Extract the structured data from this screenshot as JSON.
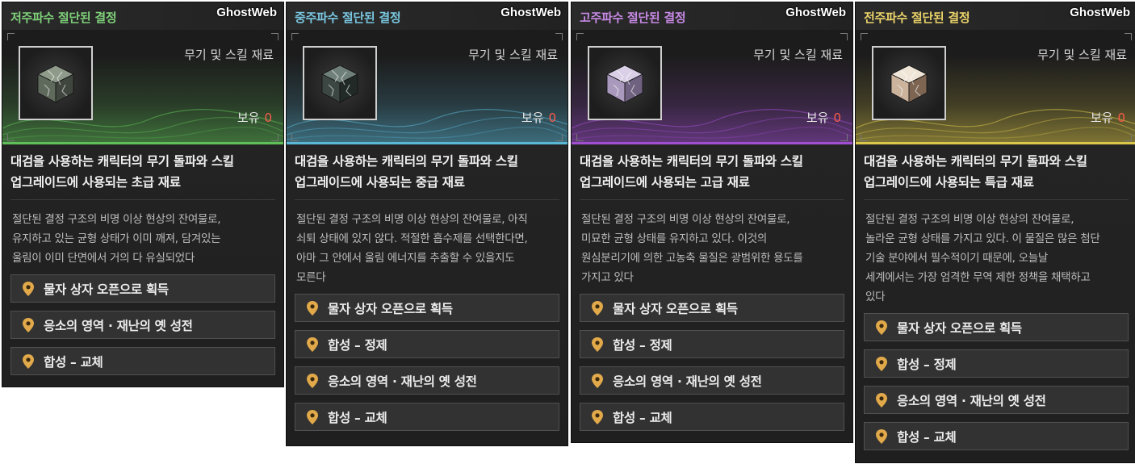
{
  "watermark": "GhostWeb",
  "cards": [
    {
      "title": "저주파수 절단된 결정",
      "title_color": "#7fd17a",
      "accent": "#5fbf58",
      "category": "무기 및 스킬 재료",
      "owned_label": "보유",
      "owned_count": "0",
      "summary": [
        "대검을 사용하는 캐릭터의 무기 돌파와 스킬",
        "업그레이드에 사용되는 초급 재료"
      ],
      "lore": [
        "절단된 결정 구조의 비명 이상 현상의 잔여물로,",
        "유지하고 있는 균형 상태가 이미 깨져, 담겨있는",
        "울림이 이미 단면에서 거의 다 유실되었다"
      ],
      "sources": [
        "물자 상자 오픈으로 획득",
        "응소의 영역 · 재난의 옛 성전",
        "합성 – 교체"
      ],
      "item_icon": "gray-crystal-cube-icon",
      "cube_colors": [
        "#8f9a8a",
        "#5f6a5c",
        "#3f463d"
      ]
    },
    {
      "title": "중주파수 절단된 결정",
      "title_color": "#79c7e0",
      "accent": "#5ab7d6",
      "category": "무기 및 스킬 재료",
      "owned_label": "보유",
      "owned_count": "0",
      "summary": [
        "대검을 사용하는 캐릭터의 무기 돌파와 스킬",
        "업그레이드에 사용되는 중급 재료"
      ],
      "lore": [
        "절단된 결정 구조의 비명 이상 현상의 잔여물로, 아직",
        "쇠퇴 상태에 있지 않다. 적절한 흡수제를 선택한다면,",
        "아마 그 안에서 울림 에너지를 추출할 수 있을지도",
        "모른다"
      ],
      "sources": [
        "물자 상자 오픈으로 획득",
        "합성 – 정제",
        "응소의 영역 · 재난의 옛 성전",
        "합성 – 교체"
      ],
      "item_icon": "dark-crystal-cube-icon",
      "cube_colors": [
        "#6f7f7a",
        "#3c4744",
        "#222a28"
      ]
    },
    {
      "title": "고주파수 절단된 결정",
      "title_color": "#c88ae6",
      "accent": "#a14fd0",
      "category": "무기 및 스킬 재료",
      "owned_label": "보유",
      "owned_count": "0",
      "summary": [
        "대검을 사용하는 캐릭터의 무기 돌파와 스킬",
        "업그레이드에 사용되는 고급 재료"
      ],
      "lore": [
        "절단된 결정 구조의 비명 이상 현상의 잔여물로,",
        "미묘한 균형 상태를 유지하고 있다. 이것의",
        "원심분리기에 의한 고농축 물질은 광범위한 용도를",
        "가지고 있다"
      ],
      "sources": [
        "물자 상자 오픈으로 획득",
        "합성 – 정제",
        "응소의 영역 · 재난의 옛 성전",
        "합성 – 교체"
      ],
      "item_icon": "violet-crystal-cube-icon",
      "cube_colors": [
        "#d9cfe6",
        "#a999bd",
        "#6f6180"
      ]
    },
    {
      "title": "전주파수 절단된 결정",
      "title_color": "#ead36a",
      "accent": "#d9c64a",
      "category": "무기 및 스킬 재료",
      "owned_label": "보유",
      "owned_count": "0",
      "summary": [
        "대검을 사용하는 캐릭터의 무기 돌파와 스킬",
        "업그레이드에 사용되는 특급 재료"
      ],
      "lore": [
        "절단된 결정 구조의 비명 이상 현상의 잔여물로,",
        "놀라운 균형 상태를 가지고 있다. 이 물질은 많은 첨단",
        "기술 분야에서 필수적이기 때문에, 오늘날",
        "세계에서는 가장 엄격한 무역 제한 정책을 채택하고",
        "있다"
      ],
      "sources": [
        "물자 상자 오픈으로 획득",
        "합성 – 정제",
        "응소의 영역 · 재난의 옛 성전",
        "합성 – 교체"
      ],
      "item_icon": "gold-crystal-cube-icon",
      "cube_colors": [
        "#f0e6d8",
        "#cbb39c",
        "#7d6552"
      ]
    }
  ]
}
